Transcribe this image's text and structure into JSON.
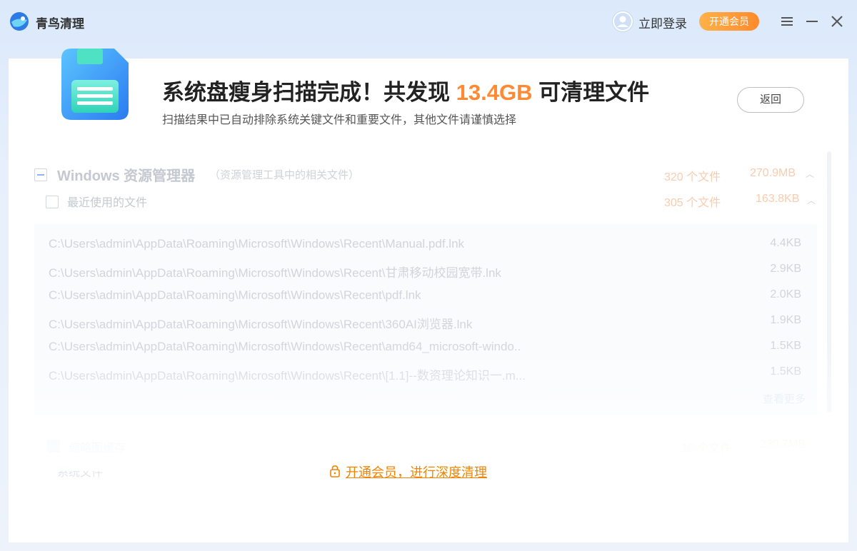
{
  "app": {
    "title": "青鸟清理"
  },
  "header": {
    "login_label": "立即登录",
    "vip_label": "开通会员"
  },
  "summary": {
    "headline_prefix": "系统盘瘦身扫描完成！共发现 ",
    "headline_size": "13.4GB",
    "headline_suffix": " 可清理文件",
    "subline": "扫描结果中已自动排除系统关键文件和重要文件，其他文件请谨慎选择",
    "back_label": "返回"
  },
  "category": {
    "title": "Windows 资源管理器",
    "desc": "（资源管理工具中的相关文件）",
    "count": "320 个文件",
    "size": "270.9MB"
  },
  "subcategory": {
    "title": "最近使用的文件",
    "count": "305 个文件",
    "size": "163.8KB"
  },
  "files": [
    {
      "path": "C:\\Users\\admin\\AppData\\Roaming\\Microsoft\\Windows\\Recent\\Manual.pdf.lnk",
      "size": "4.4KB"
    },
    {
      "path": "C:\\Users\\admin\\AppData\\Roaming\\Microsoft\\Windows\\Recent\\甘肃移动校园宽带.lnk",
      "size": "2.9KB"
    },
    {
      "path": "C:\\Users\\admin\\AppData\\Roaming\\Microsoft\\Windows\\Recent\\pdf.lnk",
      "size": "2.0KB"
    },
    {
      "path": "C:\\Users\\admin\\AppData\\Roaming\\Microsoft\\Windows\\Recent\\360AI浏览器.lnk",
      "size": "1.9KB"
    },
    {
      "path": "C:\\Users\\admin\\AppData\\Roaming\\Microsoft\\Windows\\Recent\\amd64_microsoft-windo..",
      "size": "1.5KB"
    },
    {
      "path": "C:\\Users\\admin\\AppData\\Roaming\\Microsoft\\Windows\\Recent\\[1.1]--数资理论知识一.m...",
      "size": "1.5KB"
    }
  ],
  "more_label": "查看更多",
  "category2": {
    "title": "缩略图缓存",
    "count": "15 个文件",
    "size": "230.7MB"
  },
  "category3": {
    "title": "系统文件"
  },
  "deep_clean_label": "开通会员，进行深度清理",
  "colors": {
    "accent_orange": "#ff8a33",
    "link_orange": "#f08400",
    "vip_gradient_start": "#ffb24a",
    "vip_gradient_end": "#ff8a2a"
  }
}
